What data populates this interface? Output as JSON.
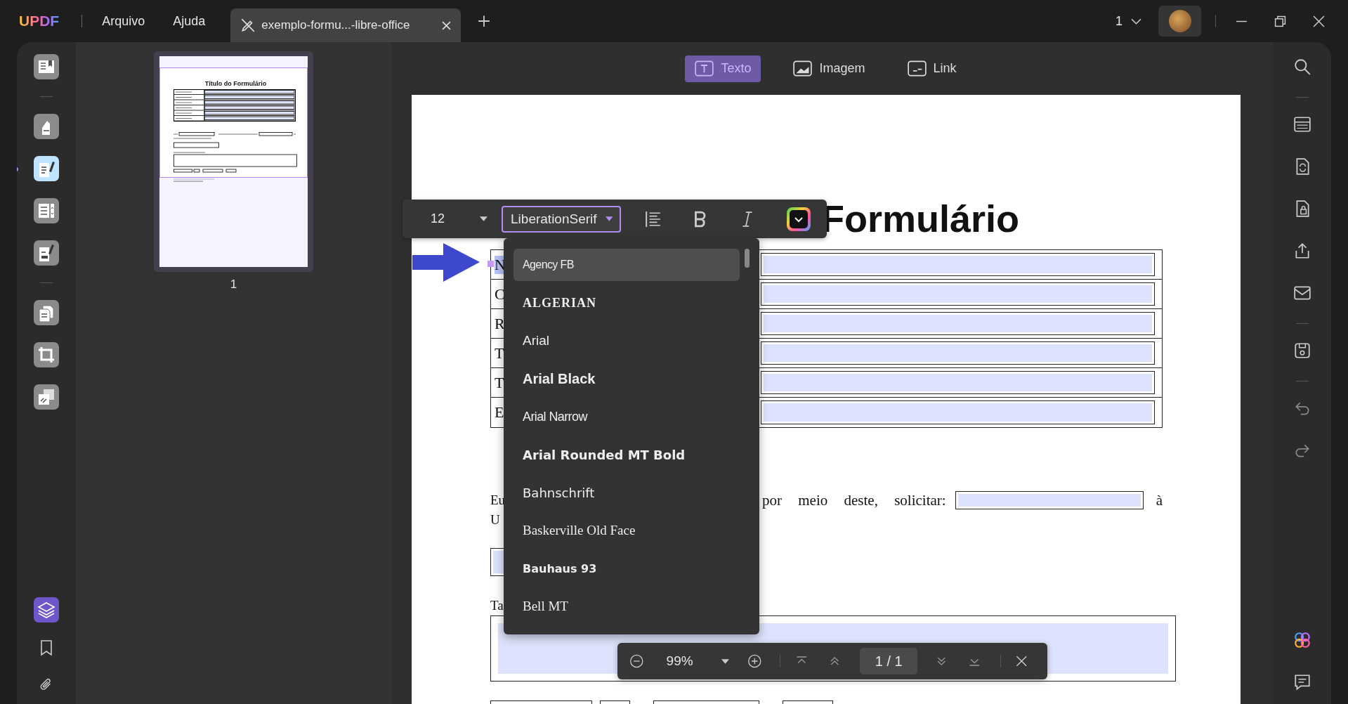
{
  "header": {
    "logo": "UPDF",
    "menu": [
      "Arquivo",
      "Ajuda"
    ],
    "tabs": [
      {
        "title": "exemplo-formu...-libre-office",
        "selected": true
      }
    ],
    "page_count": "1"
  },
  "tools": [
    {
      "selected": false
    },
    {
      "selected": false
    },
    {
      "selected": true
    },
    {
      "selected": false
    },
    {
      "selected": false
    },
    {
      "selected": false
    },
    {
      "selected": false
    },
    {
      "selected": false
    }
  ],
  "thumbnail": {
    "title": "Título do Formulário",
    "page_number": "1"
  },
  "edit_modes": [
    {
      "label": "Texto",
      "selected": true
    },
    {
      "label": "Imagem",
      "selected": false
    },
    {
      "label": "Link",
      "selected": false
    }
  ],
  "document": {
    "title": "Formulário",
    "rows": [
      {
        "label": "N",
        "selected": true
      },
      {
        "label": "C",
        "selected": false
      },
      {
        "label": "R",
        "selected": false
      },
      {
        "label": "T",
        "selected": false
      },
      {
        "label": "T",
        "selected": false
      },
      {
        "label": "E",
        "selected": false
      }
    ],
    "request_start": "Eu",
    "request_text": "por meio deste, solicitar:",
    "request_end": "à",
    "second_line": "U",
    "reason_label": "Ta"
  },
  "format_toolbar": {
    "font_size": "12",
    "font": "LiberationSerif"
  },
  "font_menu": [
    {
      "name": "Agency FB",
      "kind": "condensed",
      "selected": true
    },
    {
      "name": "ALGERIAN",
      "kind": "decorative",
      "selected": false
    },
    {
      "name": "Arial",
      "kind": "sans",
      "selected": false
    },
    {
      "name": "Arial Black",
      "kind": "black",
      "selected": false
    },
    {
      "name": "Arial Narrow",
      "kind": "narrow",
      "selected": false
    },
    {
      "name": "Arial Rounded MT Bold",
      "kind": "rounded",
      "selected": false
    },
    {
      "name": "Bahnschrift",
      "kind": "geometric",
      "selected": false
    },
    {
      "name": "Baskerville Old Face",
      "kind": "serif",
      "selected": false
    },
    {
      "name": "Bauhaus 93",
      "kind": "display",
      "selected": false
    },
    {
      "name": "Bell MT",
      "kind": "serif",
      "selected": false
    }
  ],
  "zoom_bar": {
    "zoom": "99%",
    "page": "1 / 1"
  }
}
